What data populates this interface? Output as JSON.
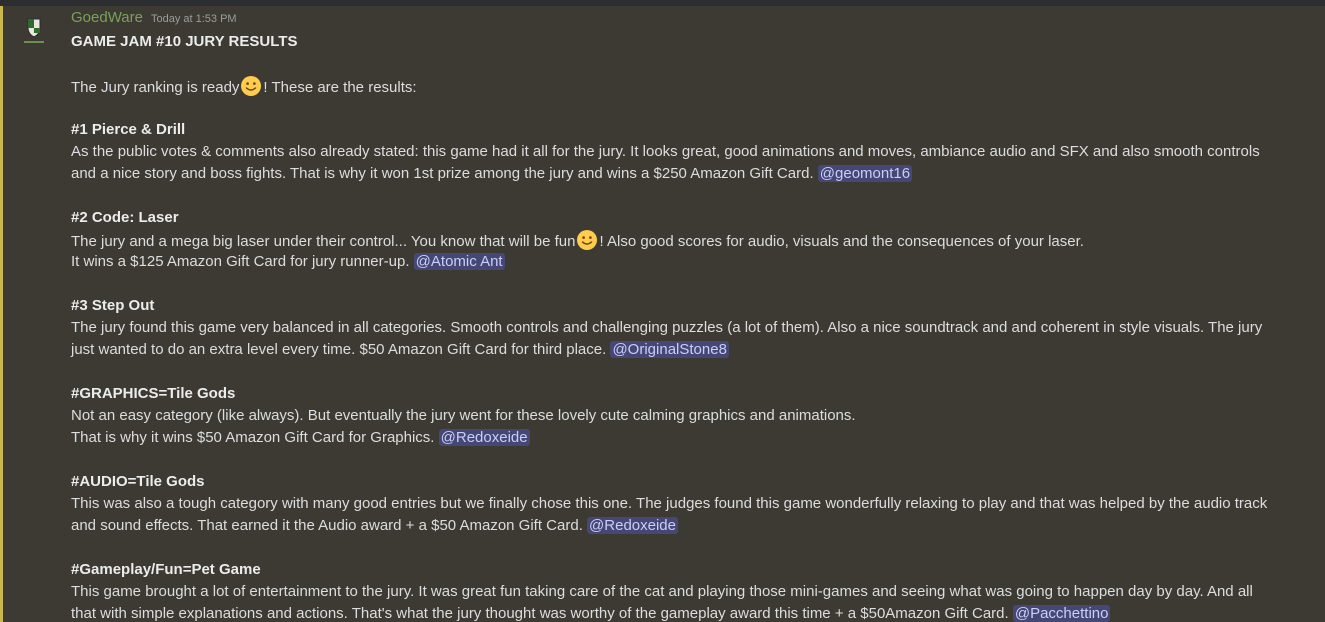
{
  "message": {
    "author": "GoedWare",
    "timestamp": "Today at 1:53 PM",
    "title": "GAME JAM #10 JURY RESULTS",
    "intro_a": "The Jury ranking is ready",
    "intro_b": "! These are the results:",
    "emoji_name": "slightly-smiling-face-icon",
    "sections": [
      {
        "heading": "#1  Pierce & Drill",
        "line1": "As the public votes & comments also already stated: this game had it all for the jury. It looks great, good animations and moves, ambiance audio and SFX and also smooth controls",
        "line2": "and a nice story and boss fights. That is why it won 1st prize among the jury and wins a $250 Amazon Gift Card.",
        "mention": "@geomont16"
      },
      {
        "heading": "#2 Code: Laser",
        "line1a": "The jury and a mega big laser under their control... You know that will be fun",
        "line1b": "! Also good scores for audio, visuals and the consequences of your laser.",
        "line2": "It wins a $125 Amazon Gift Card for jury runner-up.",
        "mention": "@Atomic Ant"
      },
      {
        "heading": "#3 Step Out",
        "line1": "The jury found this game very balanced in all categories. Smooth controls and challenging puzzles (a lot of them). Also a nice soundtrack and and coherent in style visuals. The jury",
        "line2": "just wanted to do an extra level every time. $50 Amazon Gift Card for third place.",
        "mention": "@OriginalStone8"
      },
      {
        "heading": "#GRAPHICS=Tile Gods",
        "line1": "Not an easy category (like always). But eventually the jury went for these lovely cute calming graphics and animations.",
        "line2": "That is why it wins $50 Amazon Gift Card for Graphics.",
        "mention": "@Redoxeide"
      },
      {
        "heading": "#AUDIO=Tile Gods",
        "line1": "This was also a tough category with many good entries but we finally chose this one. The judges found this game wonderfully relaxing to play and that was helped by the audio track",
        "line2": "and sound effects. That earned it the Audio award + a $50 Amazon Gift Card.",
        "mention": "@Redoxeide"
      },
      {
        "heading": "#Gameplay/Fun=Pet Game",
        "line1": "This game brought a lot of entertainment to the jury. It was great fun taking care of the cat and playing those mini-games and seeing what was going to happen day by day. And all",
        "line2": "that with simple explanations and actions. That's what the jury thought was worthy of the gameplay award this time + a $50Amazon Gift Card.",
        "mention": "@Pacchettino"
      }
    ]
  }
}
